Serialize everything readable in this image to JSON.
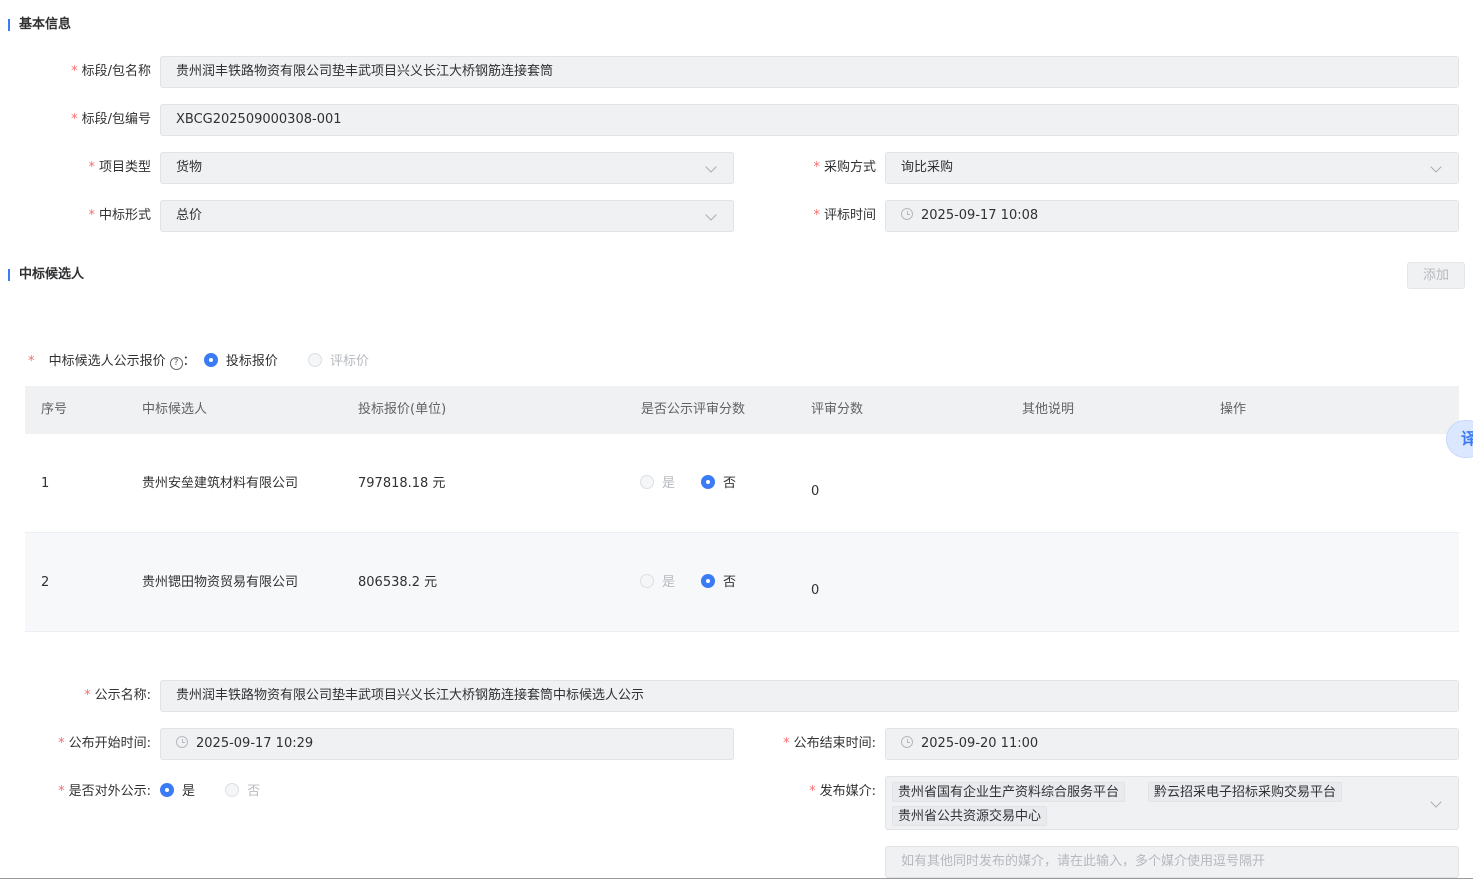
{
  "basic": {
    "section_title": "基本信息",
    "name_label": "标段/包名称",
    "name_value": "贵州润丰铁路物资有限公司垫丰武项目兴义长江大桥钢筋连接套筒",
    "code_label": "标段/包编号",
    "code_value": "XBCG202509000308-001",
    "type_label": "项目类型",
    "type_value": "货物",
    "method_label": "采购方式",
    "method_value": "询比采购",
    "award_label": "中标形式",
    "award_value": "总价",
    "eval_time_label": "评标时间",
    "eval_time_value": "2025-09-17 10:08",
    "required_mark": "*"
  },
  "candidates": {
    "section_title": "中标候选人",
    "add_button": "添加",
    "price_label": "中标候选人公示报价",
    "help_glyph": "?",
    "price_sep": "：",
    "price_opt_bid": "投标报价",
    "price_opt_eval": "评标价",
    "columns": [
      "序号",
      "中标候选人",
      "投标报价(单位)",
      "是否公示评审分数",
      "评审分数",
      "其他说明",
      "操作"
    ],
    "yes": "是",
    "no": "否",
    "rows": [
      {
        "index": "1",
        "name": "贵州安垒建筑材料有限公司",
        "price": "797818.18 元",
        "score": "0"
      },
      {
        "index": "2",
        "name": "贵州锶田物资贸易有限公司",
        "price": "806538.2 元",
        "score": "0"
      }
    ]
  },
  "notice": {
    "title_label": "公示名称:",
    "title_value": "贵州润丰铁路物资有限公司垫丰武项目兴义长江大桥钢筋连接套筒中标候选人公示",
    "start_label": "公布开始时间:",
    "start_value": "2025-09-17 10:29",
    "end_label": "公布结束时间:",
    "end_value": "2025-09-20 11:00",
    "public_label": "是否对外公示:",
    "public_yes": "是",
    "public_no": "否",
    "media_label": "发布媒介:",
    "media_tags": [
      "贵州省国有企业生产资料综合服务平台",
      "黔云招采电子招标采购交易平台",
      "贵州省公共资源交易中心"
    ],
    "other_media_placeholder": "如有其他同时发布的媒介，请在此输入，多个媒介使用逗号隔开"
  },
  "float_tab": {
    "glyph": "译"
  }
}
